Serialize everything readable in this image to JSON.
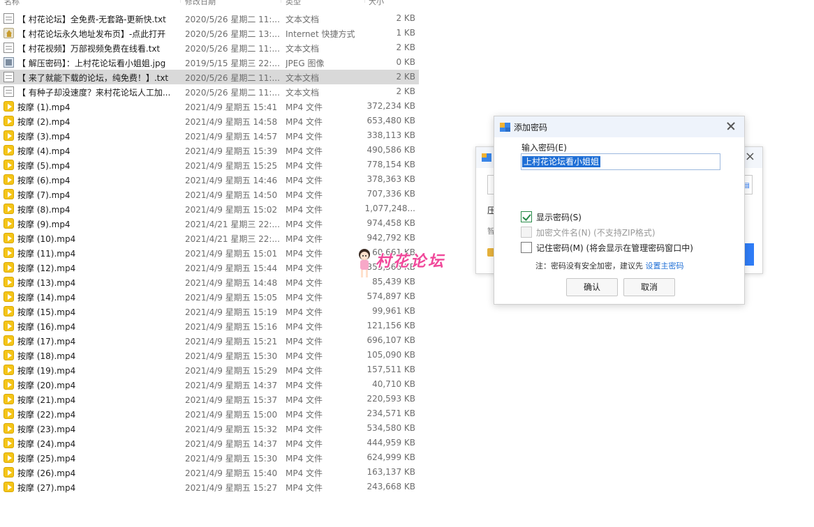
{
  "file_list": {
    "headers": {
      "name": "名称",
      "date": "修改日期",
      "type": "类型",
      "size": "大小"
    },
    "rows": [
      {
        "name": "【 村花论坛】全免费-无套路-更新快.txt",
        "date": "2020/5/26 星期二 11:...",
        "type": "文本文档",
        "size": "2 KB",
        "icon": "txt"
      },
      {
        "name": "【 村花论坛永久地址发布页】-点此打开",
        "date": "2020/5/26 星期二 13:...",
        "type": "Internet 快捷方式",
        "size": "1 KB",
        "icon": "url"
      },
      {
        "name": "【 村花视频】万部视频免费在线看.txt",
        "date": "2020/5/26 星期二 11:...",
        "type": "文本文档",
        "size": "2 KB",
        "icon": "txt"
      },
      {
        "name": "【 解压密码】：上村花论坛看小姐姐.jpg",
        "date": "2019/5/15 星期三 22:...",
        "type": "JPEG 图像",
        "size": "0 KB",
        "icon": "jpg"
      },
      {
        "name": "【 来了就能下载的论坛，纯免费！】.txt",
        "date": "2020/5/26 星期二 11:...",
        "type": "文本文档",
        "size": "2 KB",
        "icon": "txt",
        "selected": true
      },
      {
        "name": "【 有种子却没速度？来村花论坛人工加...",
        "date": "2020/5/26 星期二 11:...",
        "type": "文本文档",
        "size": "2 KB",
        "icon": "txt"
      },
      {
        "name": "按摩 (1).mp4",
        "date": "2021/4/9 星期五 15:41",
        "type": "MP4 文件",
        "size": "372,234 KB",
        "icon": "mp4"
      },
      {
        "name": "按摩 (2).mp4",
        "date": "2021/4/9 星期五 14:58",
        "type": "MP4 文件",
        "size": "653,480 KB",
        "icon": "mp4"
      },
      {
        "name": "按摩 (3).mp4",
        "date": "2021/4/9 星期五 14:57",
        "type": "MP4 文件",
        "size": "338,113 KB",
        "icon": "mp4"
      },
      {
        "name": "按摩 (4).mp4",
        "date": "2021/4/9 星期五 15:39",
        "type": "MP4 文件",
        "size": "490,586 KB",
        "icon": "mp4"
      },
      {
        "name": "按摩 (5).mp4",
        "date": "2021/4/9 星期五 15:25",
        "type": "MP4 文件",
        "size": "778,154 KB",
        "icon": "mp4"
      },
      {
        "name": "按摩 (6).mp4",
        "date": "2021/4/9 星期五 14:46",
        "type": "MP4 文件",
        "size": "378,363 KB",
        "icon": "mp4"
      },
      {
        "name": "按摩 (7).mp4",
        "date": "2021/4/9 星期五 14:50",
        "type": "MP4 文件",
        "size": "707,336 KB",
        "icon": "mp4"
      },
      {
        "name": "按摩 (8).mp4",
        "date": "2021/4/9 星期五 15:02",
        "type": "MP4 文件",
        "size": "1,077,248...",
        "icon": "mp4"
      },
      {
        "name": "按摩 (9).mp4",
        "date": "2021/4/21 星期三 22:...",
        "type": "MP4 文件",
        "size": "974,458 KB",
        "icon": "mp4"
      },
      {
        "name": "按摩 (10).mp4",
        "date": "2021/4/21 星期三 22:...",
        "type": "MP4 文件",
        "size": "942,792 KB",
        "icon": "mp4"
      },
      {
        "name": "按摩 (11).mp4",
        "date": "2021/4/9 星期五 15:01",
        "type": "MP4 文件",
        "size": "60,661 KB",
        "icon": "mp4"
      },
      {
        "name": "按摩 (12).mp4",
        "date": "2021/4/9 星期五 15:44",
        "type": "MP4 文件",
        "size": "355,366 KB",
        "icon": "mp4"
      },
      {
        "name": "按摩 (13).mp4",
        "date": "2021/4/9 星期五 14:48",
        "type": "MP4 文件",
        "size": "85,439 KB",
        "icon": "mp4"
      },
      {
        "name": "按摩 (14).mp4",
        "date": "2021/4/9 星期五 15:05",
        "type": "MP4 文件",
        "size": "574,897 KB",
        "icon": "mp4"
      },
      {
        "name": "按摩 (15).mp4",
        "date": "2021/4/9 星期五 15:19",
        "type": "MP4 文件",
        "size": "99,961 KB",
        "icon": "mp4"
      },
      {
        "name": "按摩 (16).mp4",
        "date": "2021/4/9 星期五 15:16",
        "type": "MP4 文件",
        "size": "121,156 KB",
        "icon": "mp4"
      },
      {
        "name": "按摩 (17).mp4",
        "date": "2021/4/9 星期五 15:21",
        "type": "MP4 文件",
        "size": "696,107 KB",
        "icon": "mp4"
      },
      {
        "name": "按摩 (18).mp4",
        "date": "2021/4/9 星期五 15:30",
        "type": "MP4 文件",
        "size": "105,090 KB",
        "icon": "mp4"
      },
      {
        "name": "按摩 (19).mp4",
        "date": "2021/4/9 星期五 15:29",
        "type": "MP4 文件",
        "size": "157,511 KB",
        "icon": "mp4"
      },
      {
        "name": "按摩 (20).mp4",
        "date": "2021/4/9 星期五 14:37",
        "type": "MP4 文件",
        "size": "40,710 KB",
        "icon": "mp4"
      },
      {
        "name": "按摩 (21).mp4",
        "date": "2021/4/9 星期五 15:37",
        "type": "MP4 文件",
        "size": "220,593 KB",
        "icon": "mp4"
      },
      {
        "name": "按摩 (22).mp4",
        "date": "2021/4/9 星期五 15:00",
        "type": "MP4 文件",
        "size": "234,571 KB",
        "icon": "mp4"
      },
      {
        "name": "按摩 (23).mp4",
        "date": "2021/4/9 星期五 15:32",
        "type": "MP4 文件",
        "size": "534,580 KB",
        "icon": "mp4"
      },
      {
        "name": "按摩 (24).mp4",
        "date": "2021/4/9 星期五 14:37",
        "type": "MP4 文件",
        "size": "444,959 KB",
        "icon": "mp4"
      },
      {
        "name": "按摩 (25).mp4",
        "date": "2021/4/9 星期五 15:30",
        "type": "MP4 文件",
        "size": "624,999 KB",
        "icon": "mp4"
      },
      {
        "name": "按摩 (26).mp4",
        "date": "2021/4/9 星期五 15:40",
        "type": "MP4 文件",
        "size": "163,137 KB",
        "icon": "mp4"
      },
      {
        "name": "按摩 (27).mp4",
        "date": "2021/4/9 星期五 15:27",
        "type": "MP4 文件",
        "size": "243,668 KB",
        "icon": "mp4"
      }
    ]
  },
  "back_dialog": {
    "label1": "压",
    "label2": "智"
  },
  "watermark": {
    "text": "村花论坛"
  },
  "dialog": {
    "title": "添加密码",
    "password_label": "输入密码(E)",
    "password_value": "上村花论坛看小姐姐",
    "show_password_label": "显示密码(S)",
    "encrypt_filenames_label": "加密文件名(N) (不支持ZIP格式)",
    "remember_password_label": "记住密码(M) (将会显示在管理密码窗口中)",
    "note_prefix": "注：密码没有安全加密，建议先 ",
    "note_link": "设置主密码",
    "ok_button": "确认",
    "cancel_button": "取消"
  },
  "colors": {
    "accent": "#1f6fd6",
    "watermark": "#f0489a",
    "mp4_icon": "#f5c518",
    "selected_row": "#d9d9d9"
  }
}
